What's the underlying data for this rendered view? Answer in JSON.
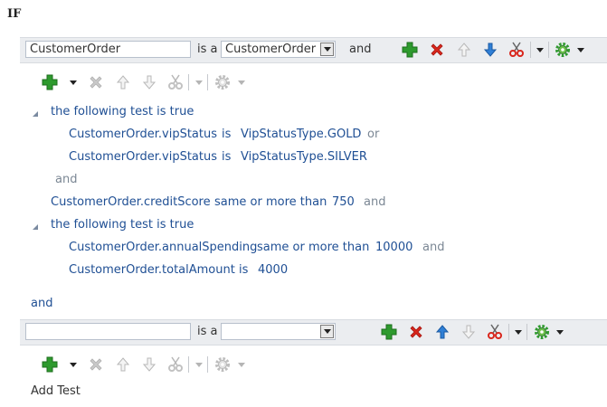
{
  "if_label": "IF",
  "condition1": {
    "field_value": "CustomerOrder",
    "is_a_label": "is a",
    "type_value": "CustomerOrder",
    "and_label": "and"
  },
  "tests": {
    "group1_label": "the following test is true",
    "g1_line1": {
      "left": "CustomerOrder.vipStatus",
      "op": "is",
      "right": "VipStatusType.GOLD",
      "conj": "or"
    },
    "g1_line2": {
      "left": "CustomerOrder.vipStatus",
      "op": "is",
      "right": "VipStatusType.SILVER"
    },
    "g1_and": "and",
    "credit": {
      "left": "CustomerOrder.creditScore",
      "op": "same or more than",
      "right": "750",
      "conj": "and"
    },
    "group2_label": "the following test is true",
    "g2_line1": {
      "left": "CustomerOrder.annualSpending",
      "op": "same or more than",
      "right": "10000",
      "conj": "and"
    },
    "g2_line2": {
      "left": "CustomerOrder.totalAmount",
      "op": "is",
      "right": "4000"
    }
  },
  "between_and": "and",
  "condition2": {
    "field_value": "",
    "is_a_label": "is a",
    "type_value": ""
  },
  "add_test_label": "Add Test",
  "colors": {
    "green": "#2e9a2e",
    "red": "#d9261c",
    "blue": "#2f7fd6",
    "text_blue": "#1f4f94"
  },
  "icons": [
    "add-icon",
    "delete-icon",
    "move-up-icon",
    "move-down-icon",
    "cut-icon",
    "gear-icon",
    "dropdown-arrow-icon",
    "collapse-triangle-icon"
  ]
}
